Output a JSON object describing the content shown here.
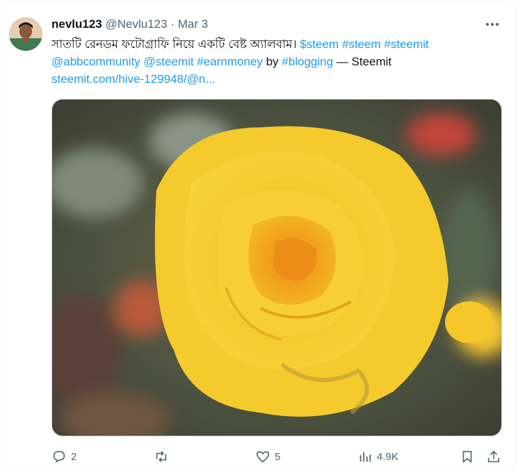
{
  "author": {
    "name": "nevlu123",
    "handle": "@Nevlu123",
    "separator": "·",
    "date": "Mar 3"
  },
  "tweet": {
    "text_bengali": "সাতটি রেনডম ফটোগ্রাফি নিয়ে একটি বেষ্ট অ্যালবাম।",
    "cashtag": "$steem",
    "hashtag_1": "#steem",
    "hashtag_2": "#steemit",
    "mention_1": "@abbcommunity",
    "mention_2": "@steemit",
    "hashtag_3": "#earnmoney",
    "by_word": "by",
    "hashtag_4": "#blogging",
    "suffix": "— Steemit",
    "link": "steemit.com/hive-129948/@n..."
  },
  "media": {
    "description_icon": "photo"
  },
  "actions": {
    "replies": "2",
    "retweets": "",
    "likes": "5",
    "views": "4.9K"
  },
  "colors": {
    "link": "#1d9bf0",
    "text": "#0f1419",
    "muted": "#536471"
  }
}
